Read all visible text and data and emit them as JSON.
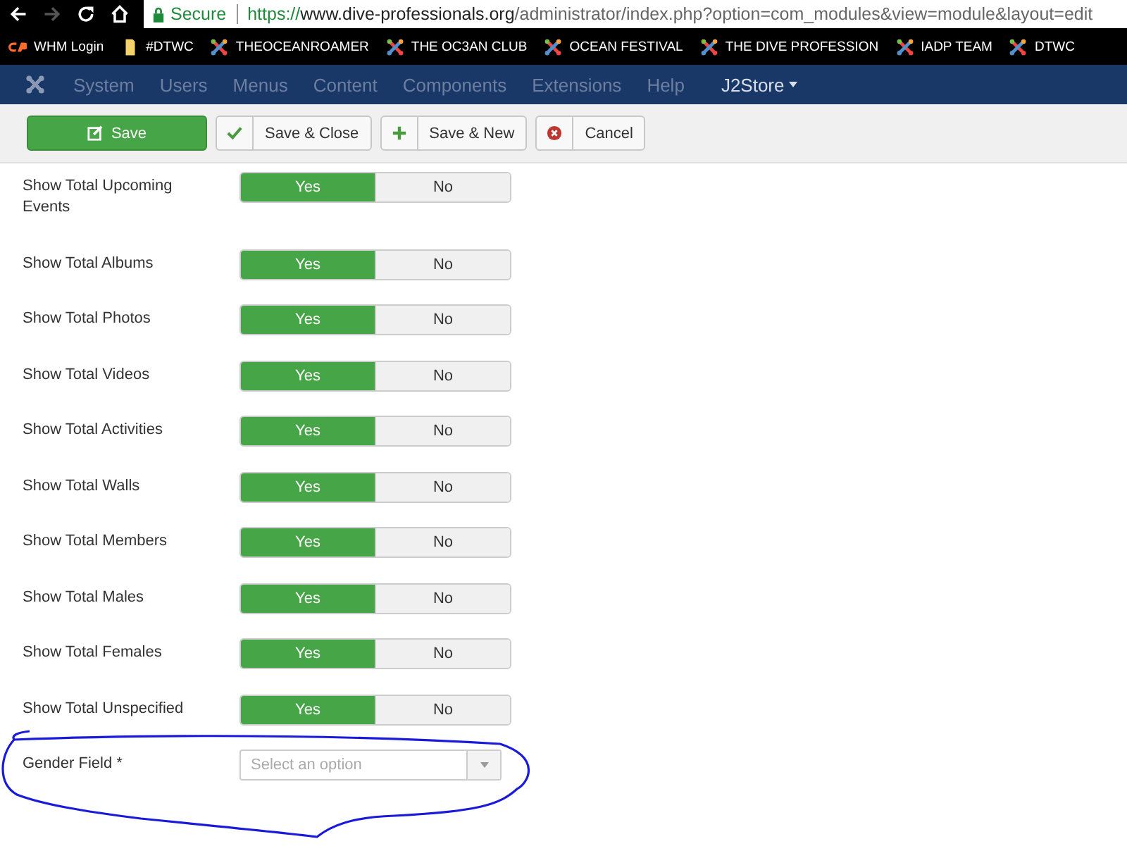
{
  "browser": {
    "security": "Secure",
    "url": {
      "scheme": "https://",
      "host": "www.dive-professionals.org",
      "path": "/administrator/index.php?option=com_modules&view=module&layout=edit"
    },
    "forward_disabled": true
  },
  "bookmarks": [
    {
      "kind": "cpanel",
      "label": "WHM Login"
    },
    {
      "kind": "folder",
      "label": "#DTWC"
    },
    {
      "kind": "joomla",
      "label": "THEOCEANROAMER"
    },
    {
      "kind": "joomla",
      "label": "THE OC3AN CLUB"
    },
    {
      "kind": "joomla",
      "label": "OCEAN FESTIVAL"
    },
    {
      "kind": "joomla",
      "label": "THE DIVE PROFESSION"
    },
    {
      "kind": "joomla",
      "label": "IADP TEAM"
    },
    {
      "kind": "joomla",
      "label": "DTWC"
    }
  ],
  "nav": {
    "items": [
      {
        "label": "System",
        "dropdown": false
      },
      {
        "label": "Users",
        "dropdown": false
      },
      {
        "label": "Menus",
        "dropdown": false
      },
      {
        "label": "Content",
        "dropdown": false
      },
      {
        "label": "Components",
        "dropdown": false
      },
      {
        "label": "Extensions",
        "dropdown": false
      },
      {
        "label": "Help",
        "dropdown": false
      },
      {
        "label": "J2Store",
        "dropdown": true
      }
    ]
  },
  "toolbar": [
    {
      "kind": "save",
      "label": "Save"
    },
    {
      "kind": "check",
      "label": "Save & Close"
    },
    {
      "kind": "plus",
      "label": "Save & New"
    },
    {
      "kind": "cancel",
      "label": "Cancel"
    }
  ],
  "fields": [
    {
      "label": "Show Total Upcoming Events",
      "options": [
        {
          "label": "Yes",
          "selected": true
        },
        {
          "label": "No",
          "selected": false
        }
      ]
    },
    {
      "label": "Show Total Albums",
      "options": [
        {
          "label": "Yes",
          "selected": true
        },
        {
          "label": "No",
          "selected": false
        }
      ]
    },
    {
      "label": "Show Total Photos",
      "options": [
        {
          "label": "Yes",
          "selected": true
        },
        {
          "label": "No",
          "selected": false
        }
      ]
    },
    {
      "label": "Show Total Videos",
      "options": [
        {
          "label": "Yes",
          "selected": true
        },
        {
          "label": "No",
          "selected": false
        }
      ]
    },
    {
      "label": "Show Total Activities",
      "options": [
        {
          "label": "Yes",
          "selected": true
        },
        {
          "label": "No",
          "selected": false
        }
      ]
    },
    {
      "label": "Show Total Walls",
      "options": [
        {
          "label": "Yes",
          "selected": true
        },
        {
          "label": "No",
          "selected": false
        }
      ]
    },
    {
      "label": "Show Total Members",
      "options": [
        {
          "label": "Yes",
          "selected": true
        },
        {
          "label": "No",
          "selected": false
        }
      ]
    },
    {
      "label": "Show Total Males",
      "options": [
        {
          "label": "Yes",
          "selected": true
        },
        {
          "label": "No",
          "selected": false
        }
      ]
    },
    {
      "label": "Show Total Females",
      "options": [
        {
          "label": "Yes",
          "selected": true
        },
        {
          "label": "No",
          "selected": false
        }
      ]
    },
    {
      "label": "Show Total Unspecified",
      "options": [
        {
          "label": "Yes",
          "selected": true
        },
        {
          "label": "No",
          "selected": false
        }
      ]
    }
  ],
  "gender_field": {
    "label": "Gender Field *",
    "placeholder": "Select an option"
  }
}
